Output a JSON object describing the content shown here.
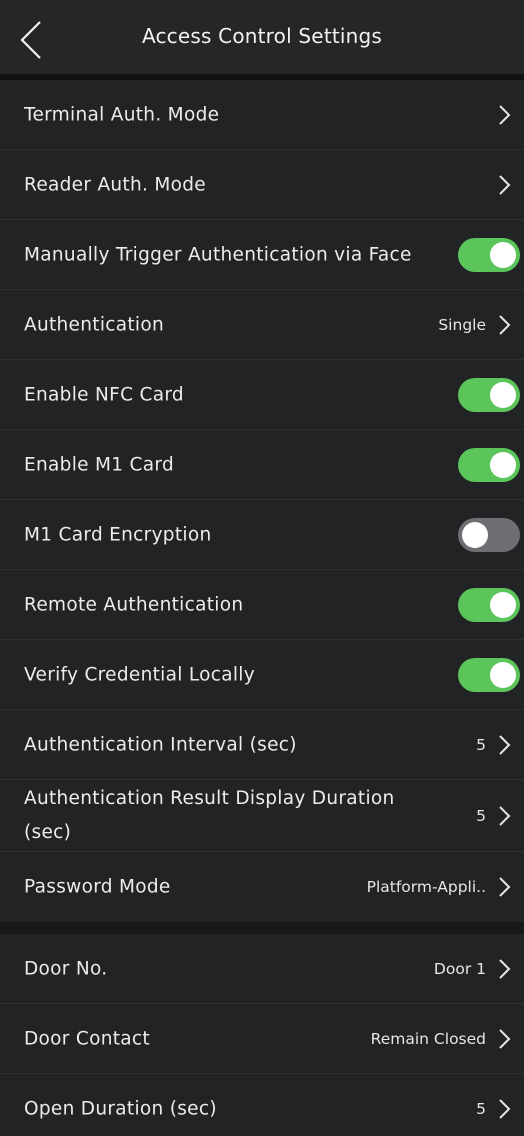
{
  "header": {
    "title": "Access Control Settings",
    "back_icon": "chevron-left-icon"
  },
  "colors": {
    "toggle_on": "#5bc55b",
    "toggle_off": "#6e6f72",
    "background": "#222325"
  },
  "section1": {
    "rows": [
      {
        "label": "Terminal Auth. Mode",
        "type": "link"
      },
      {
        "label": "Reader Auth. Mode",
        "type": "link"
      },
      {
        "label": "Manually Trigger Authentication via Face",
        "type": "toggle",
        "enabled": true
      },
      {
        "label": "Authentication",
        "type": "link",
        "value": "Single"
      },
      {
        "label": "Enable NFC Card",
        "type": "toggle",
        "enabled": true
      },
      {
        "label": "Enable M1 Card",
        "type": "toggle",
        "enabled": true
      },
      {
        "label": "M1 Card Encryption",
        "type": "toggle",
        "enabled": false
      },
      {
        "label": "Remote Authentication",
        "type": "toggle",
        "enabled": true
      },
      {
        "label": "Verify Credential Locally",
        "type": "toggle",
        "enabled": true
      },
      {
        "label": "Authentication Interval (sec)",
        "type": "link",
        "value": "5"
      },
      {
        "label": "Authentication Result Display Duration (sec)",
        "type": "link",
        "value": "5"
      },
      {
        "label": "Password Mode",
        "type": "link",
        "value": "Platform-Appli.."
      }
    ]
  },
  "section2": {
    "rows": [
      {
        "label": "Door No.",
        "type": "link",
        "value": "Door 1"
      },
      {
        "label": "Door Contact",
        "type": "link",
        "value": "Remain Closed"
      },
      {
        "label": "Open Duration (sec)",
        "type": "link",
        "value": "5"
      }
    ]
  }
}
